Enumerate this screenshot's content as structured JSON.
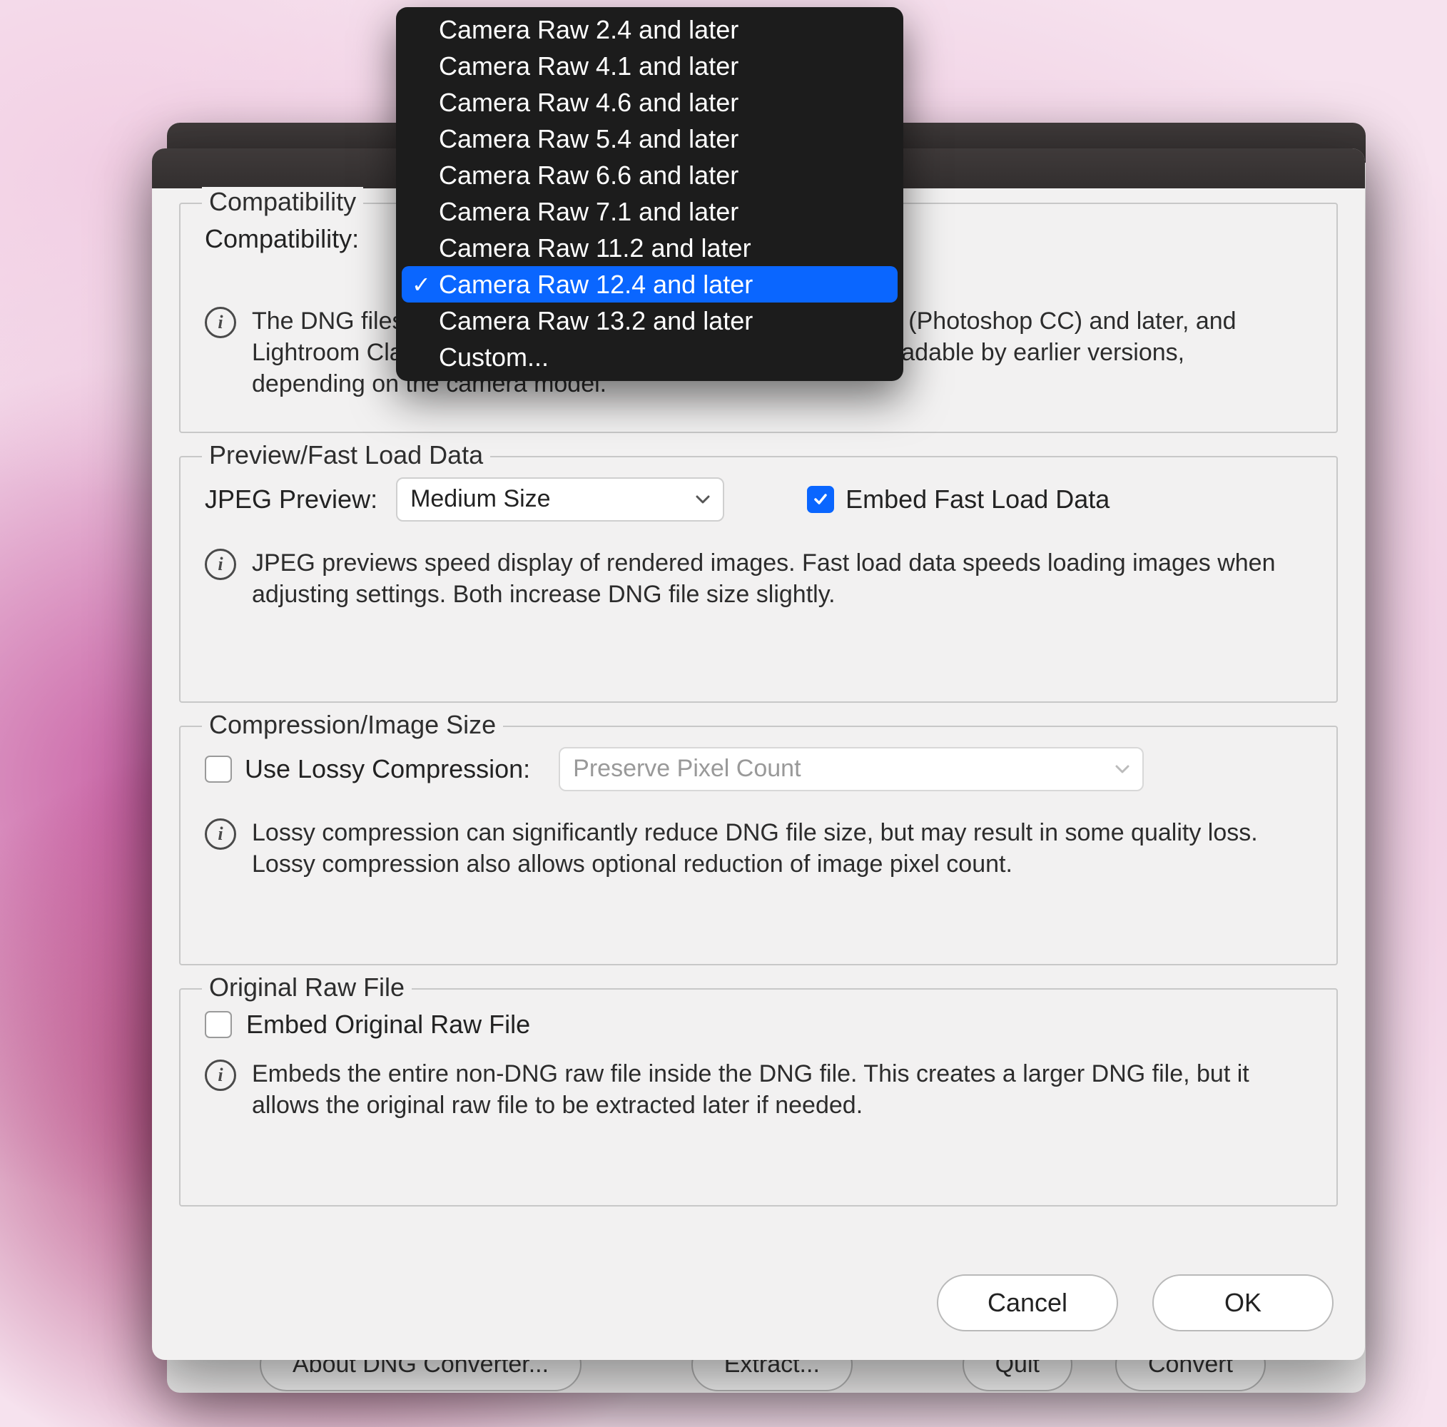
{
  "dropdown": {
    "items": [
      "Camera Raw 2.4 and later",
      "Camera Raw 4.1 and later",
      "Camera Raw 4.6 and later",
      "Camera Raw 5.4 and later",
      "Camera Raw 6.6 and later",
      "Camera Raw 7.1 and later",
      "Camera Raw 11.2 and later",
      "Camera Raw 12.4 and later",
      "Camera Raw 13.2 and later",
      "Custom..."
    ],
    "selected_index": 7
  },
  "compatibility": {
    "legend": "Compatibility",
    "label": "Compatibility:",
    "info": "The DNG files created will be readable by Camera Raw 12.4 (Photoshop CC) and later, and Lightroom Classic 9.4 and later. The DNG file will often be readable by earlier versions, depending on the camera model."
  },
  "preview": {
    "legend": "Preview/Fast Load Data",
    "jpeg_label": "JPEG Preview:",
    "jpeg_value": "Medium Size",
    "embed_label": "Embed Fast Load Data",
    "embed_checked": true,
    "info": "JPEG previews speed display of rendered images.  Fast load data speeds loading images when adjusting settings.  Both increase DNG file size slightly."
  },
  "compression": {
    "legend": "Compression/Image Size",
    "lossy_label": "Use Lossy Compression:",
    "lossy_checked": false,
    "preserve_value": "Preserve Pixel Count",
    "info": "Lossy compression can significantly reduce DNG file size, but may result in some quality loss. Lossy compression also allows optional reduction of image pixel count."
  },
  "original": {
    "legend": "Original Raw File",
    "embed_label": "Embed Original Raw File",
    "embed_checked": false,
    "info": "Embeds the entire non-DNG raw file inside the DNG file.  This creates a larger DNG file, but it allows the original raw file to be extracted later if needed."
  },
  "buttons": {
    "cancel": "Cancel",
    "ok": "OK"
  },
  "back_footer": {
    "about": "About DNG Converter...",
    "extract": "Extract...",
    "quit": "Quit",
    "convert": "Convert"
  }
}
